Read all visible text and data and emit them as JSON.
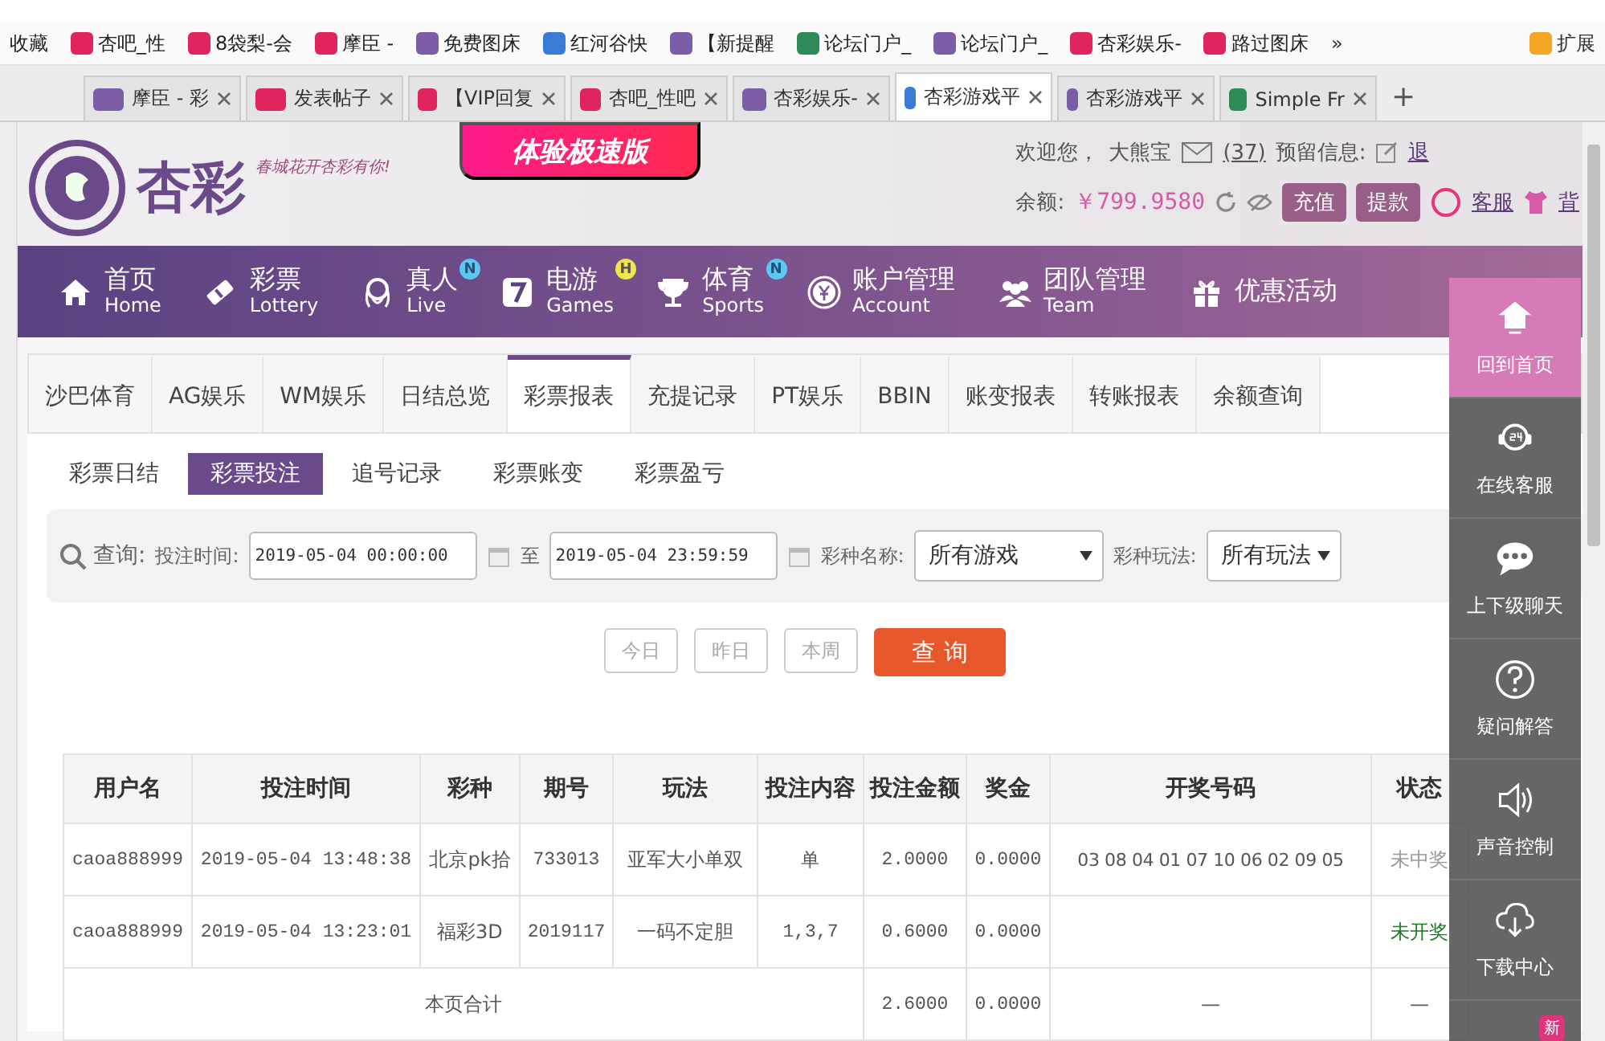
{
  "browser": {
    "bookmarks": [
      "收藏",
      "杏吧_性",
      "8袋梨-会",
      "摩臣 -",
      "免费图床",
      "红河谷快",
      "【新提醒",
      "论坛门户_",
      "论坛门户_",
      "杏彩娱乐-",
      "路过图床"
    ],
    "bookmarks_more": "»",
    "extensions": "扩展",
    "tabs": [
      {
        "title": "摩臣 - 彩",
        "selected": false
      },
      {
        "title": "发表帖子",
        "selected": false
      },
      {
        "title": "【VIP回复",
        "selected": false
      },
      {
        "title": "杏吧_性吧",
        "selected": false
      },
      {
        "title": "杏彩娱乐-",
        "selected": false
      },
      {
        "title": "杏彩游戏平",
        "selected": true
      },
      {
        "title": "杏彩游戏平",
        "selected": false
      },
      {
        "title": "Simple Fr",
        "selected": false
      }
    ],
    "new_tab": "+"
  },
  "header": {
    "logo": "杏彩",
    "slogan": "春城花开杏彩有你!",
    "banner": "体验极速版",
    "welcome": "欢迎您，",
    "username": "大熊宝",
    "messages": "(37)",
    "reserved": "预留信息:",
    "logout": "退",
    "balance_label": "余额:",
    "balance": "￥799.9580",
    "deposit": "充值",
    "withdraw": "提款",
    "service": "客服",
    "background": "背"
  },
  "nav": [
    {
      "zh": "首页",
      "en": "Home"
    },
    {
      "zh": "彩票",
      "en": "Lottery"
    },
    {
      "zh": "真人",
      "en": "Live",
      "badge": "N"
    },
    {
      "zh": "电游",
      "en": "Games",
      "badge": "H"
    },
    {
      "zh": "体育",
      "en": "Sports",
      "badge": "N"
    },
    {
      "zh": "账户管理",
      "en": "Account"
    },
    {
      "zh": "团队管理",
      "en": "Team"
    },
    {
      "zh": "优惠活动"
    }
  ],
  "report_tabs": [
    {
      "label": "沙巴体育",
      "selected": false
    },
    {
      "label": "AG娱乐",
      "selected": false
    },
    {
      "label": "WM娱乐",
      "selected": false
    },
    {
      "label": "日结总览",
      "selected": false
    },
    {
      "label": "彩票报表",
      "selected": true
    },
    {
      "label": "充提记录",
      "selected": false
    },
    {
      "label": "PT娱乐",
      "selected": false
    },
    {
      "label": "BBIN",
      "selected": false
    },
    {
      "label": "账变报表",
      "selected": false
    },
    {
      "label": "转账报表",
      "selected": false
    },
    {
      "label": "余额查询",
      "selected": false
    }
  ],
  "sub_tabs": [
    {
      "label": "彩票日结",
      "selected": false
    },
    {
      "label": "彩票投注",
      "selected": true
    },
    {
      "label": "追号记录",
      "selected": false
    },
    {
      "label": "彩票账变",
      "selected": false
    },
    {
      "label": "彩票盈亏",
      "selected": false
    }
  ],
  "query": {
    "title": "查询:",
    "time_label": "投注时间:",
    "start": "2019-05-04 00:00:00",
    "to": "至",
    "end": "2019-05-04 23:59:59",
    "game_label": "彩种名称:",
    "game": "所有游戏",
    "play_label": "彩种玩法:",
    "play": "所有玩法"
  },
  "quick_buttons": [
    "今日",
    "昨日",
    "本周"
  ],
  "search_button": "查 询",
  "table": {
    "columns": [
      "用户名",
      "投注时间",
      "彩种",
      "期号",
      "玩法",
      "投注内容",
      "投注金额",
      "奖金",
      "开奖号码",
      "状态"
    ],
    "rows": [
      {
        "cells": [
          "caoa888999",
          "2019-05-04 13:48:38",
          "北京pk拾",
          "733013",
          "亚军大小单双",
          "单",
          "2.0000",
          "0.0000",
          "03 08 04 01 07 10 06 02 09 05"
        ],
        "status": "未中奖",
        "color": "#999999"
      },
      {
        "cells": [
          "caoa888999",
          "2019-05-04 13:23:01",
          "福彩3D",
          "2019117",
          "一码不定胆",
          "1,3,7",
          "0.6000",
          "0.0000",
          ""
        ],
        "status": "未开奖",
        "color": "#1e7a1e"
      }
    ],
    "total": {
      "label": "本页合计",
      "amount": "2.6000",
      "bonus": "0.0000",
      "numbers": "—",
      "status": "—"
    }
  },
  "side_panel": [
    {
      "label": "回到首页",
      "selected": true
    },
    {
      "label": "在线客服",
      "selected": false
    },
    {
      "label": "上下级聊天",
      "selected": false
    },
    {
      "label": "疑问解答",
      "selected": false
    },
    {
      "label": "声音控制",
      "selected": false
    },
    {
      "label": "下载中心",
      "selected": false
    }
  ],
  "side_badge": "新"
}
